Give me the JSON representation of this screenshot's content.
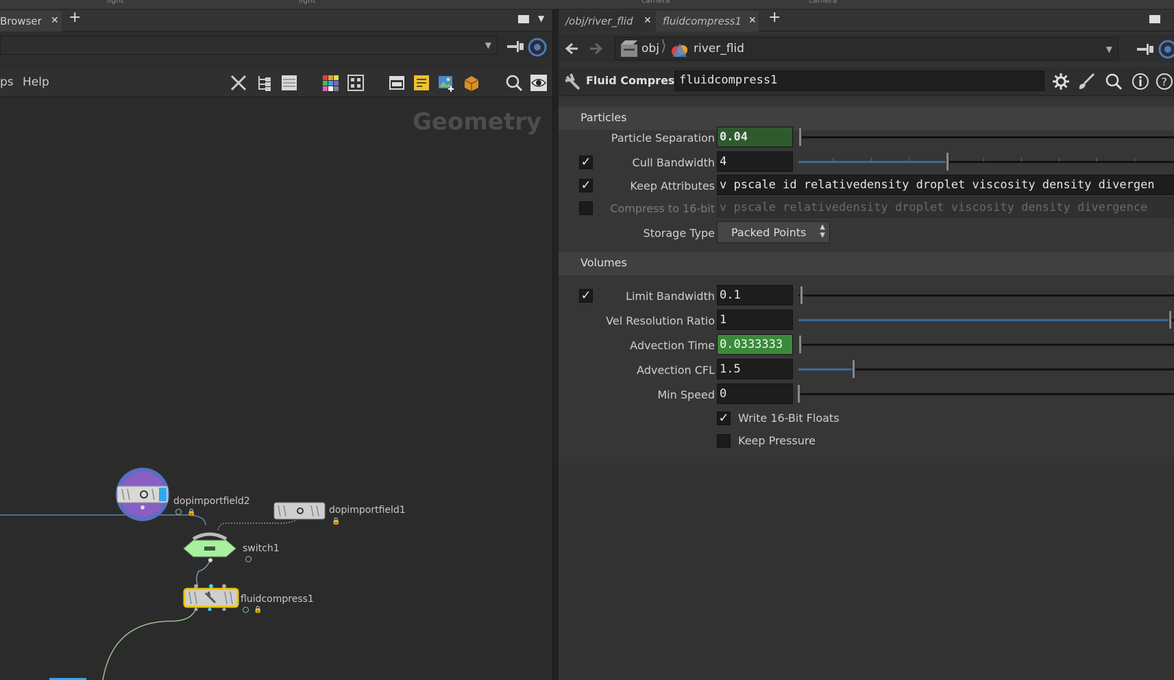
{
  "top_strip": [
    "light",
    "light",
    "camera",
    "camera"
  ],
  "left_pane": {
    "tab_label": "Browser",
    "menu": [
      "ps",
      "Help"
    ],
    "network_title": "Geometry",
    "nodes": [
      {
        "name": "dopimportfield2"
      },
      {
        "name": "dopimportfield1"
      },
      {
        "name": "switch1"
      },
      {
        "name": "fluidcompress1"
      }
    ]
  },
  "right_pane": {
    "tabs": [
      "/obj/river_flid",
      "fluidcompress1"
    ],
    "breadcrumb": {
      "level1": "obj",
      "level2": "river_flid"
    },
    "node_type": "Fluid Compress",
    "node_name": "fluidcompress1",
    "sections": {
      "particles": "Particles",
      "volumes": "Volumes"
    },
    "params": {
      "particle_separation": {
        "label": "Particle Separation",
        "value": "0.04"
      },
      "cull_bandwidth": {
        "label": "Cull Bandwidth",
        "value": "4",
        "checked": true
      },
      "keep_attributes": {
        "label": "Keep Attributes",
        "value": "v pscale id relativedensity droplet viscosity density divergen",
        "checked": true
      },
      "compress_16bit": {
        "label": "Compress to 16-bit",
        "value": "v pscale relativedensity droplet viscosity density divergence",
        "checked": false
      },
      "storage_type": {
        "label": "Storage Type",
        "value": "Packed Points"
      },
      "limit_bandwidth": {
        "label": "Limit Bandwidth",
        "value": "0.1",
        "checked": true
      },
      "vel_resolution_ratio": {
        "label": "Vel Resolution Ratio",
        "value": "1"
      },
      "advection_time": {
        "label": "Advection Time",
        "value": "0.0333333"
      },
      "advection_cfl": {
        "label": "Advection CFL",
        "value": "1.5"
      },
      "min_speed": {
        "label": "Min Speed",
        "value": "0"
      },
      "write_16bit_floats": {
        "label": "Write 16-Bit Floats",
        "checked": true
      },
      "keep_pressure": {
        "label": "Keep Pressure",
        "checked": false
      }
    }
  },
  "colors": {
    "selected_node": "#f0c800",
    "switch_node": "#a8f0a0",
    "dopimport2_ring": "#5a6fc0",
    "slider_fill": "#3a6a9a"
  }
}
